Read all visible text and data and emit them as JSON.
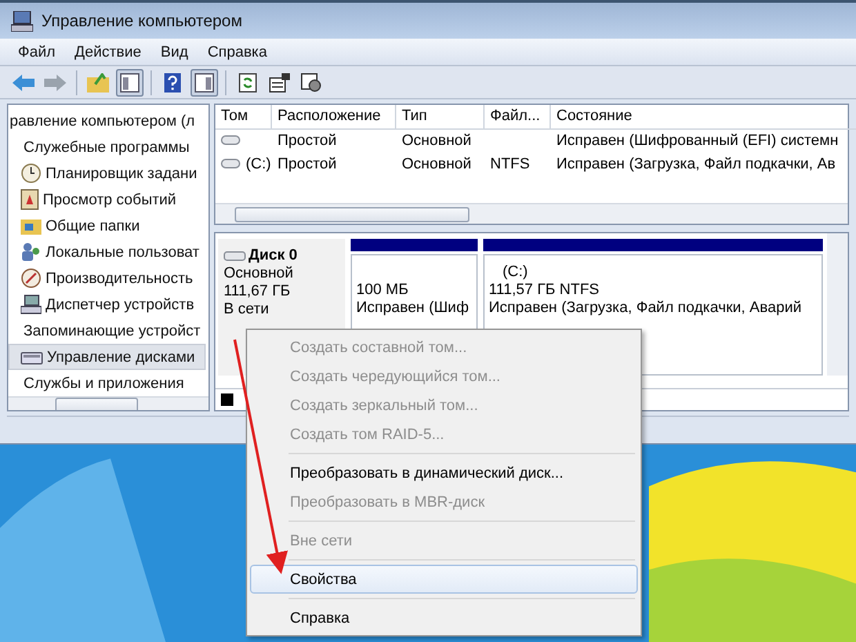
{
  "window": {
    "title": "Управление компьютером"
  },
  "menu": [
    "Файл",
    "Действие",
    "Вид",
    "Справка"
  ],
  "toolbar": [
    {
      "kind": "back",
      "pressed": false
    },
    {
      "kind": "forward",
      "pressed": false
    },
    {
      "kind": "separator"
    },
    {
      "kind": "up",
      "pressed": false
    },
    {
      "kind": "tree",
      "pressed": true
    },
    {
      "kind": "separator"
    },
    {
      "kind": "help",
      "pressed": false
    },
    {
      "kind": "pane",
      "pressed": true
    },
    {
      "kind": "separator"
    },
    {
      "kind": "refresh",
      "pressed": false
    },
    {
      "kind": "properties",
      "pressed": false
    },
    {
      "kind": "settings",
      "pressed": false
    }
  ],
  "tree": [
    {
      "label": "равление компьютером (л",
      "selected": false,
      "children": [
        {
          "label": "Служебные программы",
          "selected": false,
          "children": [
            {
              "label": "Планировщик задани",
              "kind": "clock",
              "selected": false
            },
            {
              "label": "Просмотр событий",
              "kind": "log",
              "selected": false
            },
            {
              "label": "Общие папки",
              "kind": "folder",
              "selected": false
            },
            {
              "label": "Локальные пользоват",
              "kind": "users",
              "selected": false
            },
            {
              "label": "Производительность",
              "kind": "gauge",
              "selected": false
            },
            {
              "label": "Диспетчер устройств",
              "kind": "devices",
              "selected": false
            }
          ]
        },
        {
          "label": "Запоминающие устройст",
          "selected": false,
          "children": [
            {
              "label": "Управление дисками",
              "kind": "disk",
              "selected": true
            }
          ]
        },
        {
          "label": "Службы и приложения",
          "selected": false
        }
      ]
    }
  ],
  "table": {
    "columns": [
      "Том",
      "Расположение",
      "Тип",
      "Файл...",
      "Состояние"
    ],
    "rows": [
      [
        "",
        "Простой",
        "Основной",
        "",
        "Исправен (Шифрованный (EFI) системн"
      ],
      [
        "(C:)",
        "Простой",
        "Основной",
        "NTFS",
        "Исправен (Загрузка, Файл подкачки, Ав"
      ]
    ]
  },
  "disk": {
    "name": "Диск 0",
    "type": "Основной",
    "size": "111,67 ГБ",
    "status": "В сети",
    "partitions": [
      {
        "size": "100 МБ",
        "status": "Исправен (Шиф"
      },
      {
        "label": "(C:)",
        "size": "111,57 ГБ NTFS",
        "status": "Исправен (Загрузка, Файл подкачки, Аварий"
      }
    ]
  },
  "context_menu": [
    {
      "kind": "item",
      "label": "Создать составной том...",
      "disabled": true,
      "selected": false
    },
    {
      "kind": "item",
      "label": "Создать чередующийся том...",
      "disabled": true,
      "selected": false
    },
    {
      "kind": "item",
      "label": "Создать зеркальный том...",
      "disabled": true,
      "selected": false
    },
    {
      "kind": "item",
      "label": "Создать том RAID-5...",
      "disabled": true,
      "selected": false
    },
    {
      "kind": "separator"
    },
    {
      "kind": "item",
      "label": "Преобразовать в динамический диск...",
      "disabled": false,
      "selected": false
    },
    {
      "kind": "item",
      "label": "Преобразовать в MBR-диск",
      "disabled": true,
      "selected": false
    },
    {
      "kind": "separator"
    },
    {
      "kind": "item",
      "label": "Вне сети",
      "disabled": true,
      "selected": false
    },
    {
      "kind": "separator"
    },
    {
      "kind": "item",
      "label": "Свойства",
      "disabled": false,
      "selected": true
    },
    {
      "kind": "separator"
    },
    {
      "kind": "item",
      "label": "Справка",
      "disabled": false,
      "selected": false
    }
  ]
}
